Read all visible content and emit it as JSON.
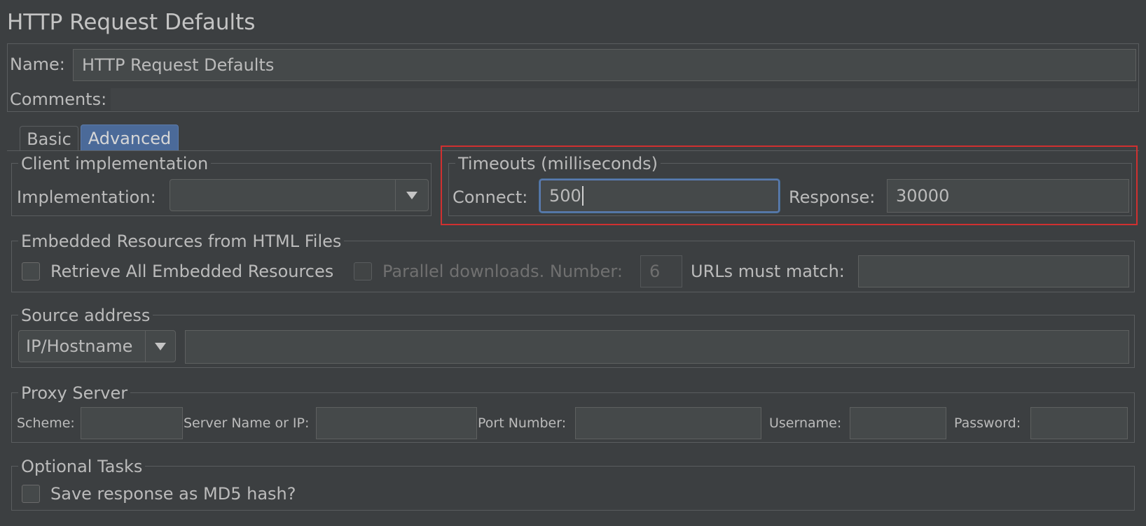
{
  "window": {
    "title": "HTTP Request Defaults"
  },
  "name_field": {
    "label": "Name:",
    "value": "HTTP Request Defaults"
  },
  "comments_field": {
    "label": "Comments:",
    "value": ""
  },
  "tabs": [
    {
      "label": "Basic",
      "active": false
    },
    {
      "label": "Advanced",
      "active": true
    }
  ],
  "client_implementation": {
    "title": "Client implementation",
    "implementation_label": "Implementation:",
    "implementation_value": ""
  },
  "timeouts": {
    "title": "Timeouts (milliseconds)",
    "connect_label": "Connect:",
    "connect_value": "500",
    "response_label": "Response:",
    "response_value": "30000"
  },
  "embedded_resources": {
    "title": "Embedded Resources from HTML Files",
    "retrieve_label": "Retrieve All Embedded Resources",
    "retrieve_checked": false,
    "parallel_label": "Parallel downloads. Number:",
    "parallel_checked": false,
    "parallel_number": "6",
    "urls_label": "URLs must match:",
    "urls_value": ""
  },
  "source_address": {
    "title": "Source address",
    "type_value": "IP/Hostname",
    "address_value": ""
  },
  "proxy_server": {
    "title": "Proxy Server",
    "scheme_label": "Scheme:",
    "server_label": "Server Name or IP:",
    "port_label": "Port Number:",
    "username_label": "Username:",
    "password_label": "Password:",
    "scheme_value": "",
    "server_value": "",
    "port_value": "",
    "username_value": "",
    "password_value": ""
  },
  "optional_tasks": {
    "title": "Optional Tasks",
    "md5_label": "Save response as MD5 hash?",
    "md5_checked": false
  },
  "colors": {
    "background": "#3c3f41",
    "active_tab": "#4b6a99",
    "focus_border": "#5a7bb0",
    "highlight_box": "#d03030"
  }
}
